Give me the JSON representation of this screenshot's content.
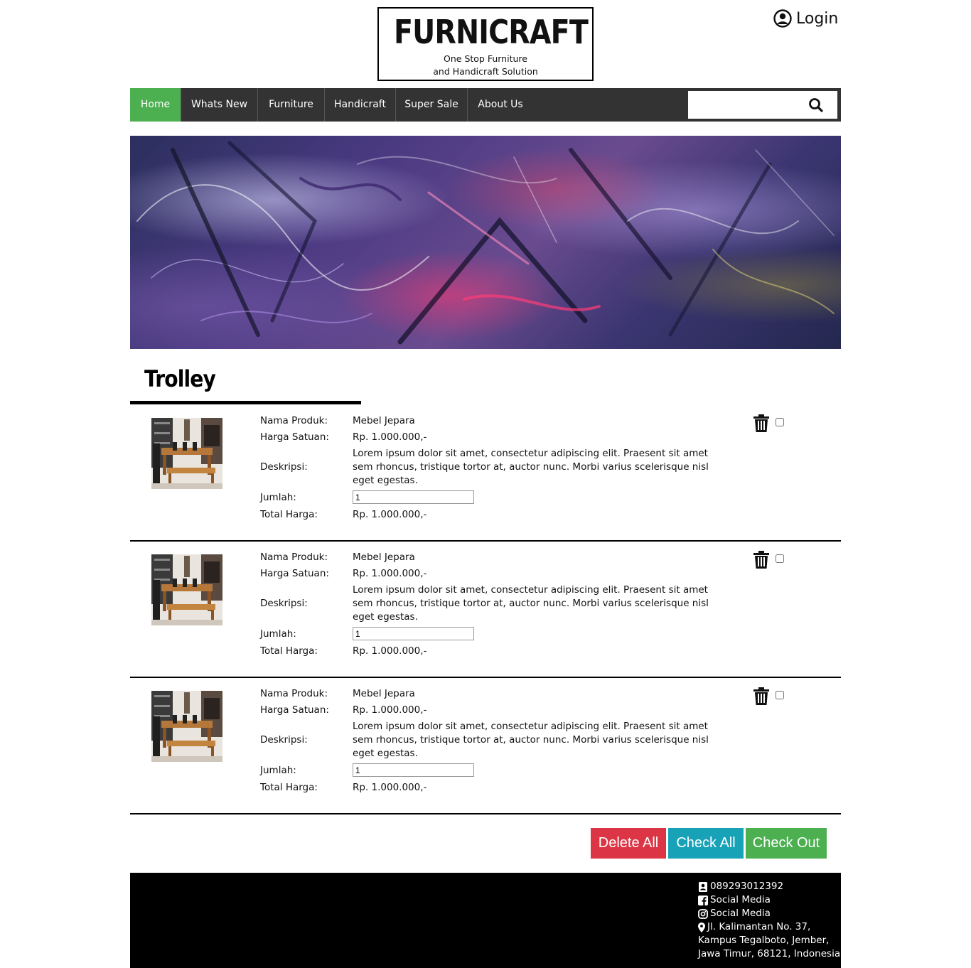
{
  "header": {
    "logo_title": "FURNICRAFT",
    "logo_tagline_1": "One Stop Furniture",
    "logo_tagline_2": "and Handicraft Solution",
    "login_label": "Login"
  },
  "nav": {
    "items": [
      {
        "label": "Home",
        "active": true
      },
      {
        "label": "Whats New",
        "active": false
      },
      {
        "label": "Furniture",
        "active": false
      },
      {
        "label": "Handicraft",
        "active": false
      },
      {
        "label": "Super Sale",
        "active": false
      },
      {
        "label": "About Us",
        "active": false
      }
    ],
    "search_placeholder": "",
    "search_icon": "search-icon",
    "active_color": "#4caf50",
    "bar_color": "#333333"
  },
  "page": {
    "title": "Trolley"
  },
  "labels": {
    "name": "Nama Produk:",
    "unit_price": "Harga Satuan:",
    "description": "Deskripsi:",
    "quantity": "Jumlah:",
    "total": "Total Harga:"
  },
  "items": [
    {
      "name": "Mebel Jepara",
      "unit_price": "Rp. 1.000.000,-",
      "description": "Lorem ipsum dolor sit amet, consectetur adipiscing elit. Praesent sit amet sem rhoncus, tristique tortor at, auctor nunc. Morbi varius scelerisque nisl eget egestas.",
      "quantity": "1",
      "total": "Rp. 1.000.000,-",
      "checked": false
    },
    {
      "name": "Mebel Jepara",
      "unit_price": "Rp. 1.000.000,-",
      "description": "Lorem ipsum dolor sit amet, consectetur adipiscing elit. Praesent sit amet sem rhoncus, tristique tortor at, auctor nunc. Morbi varius scelerisque nisl eget egestas.",
      "quantity": "1",
      "total": "Rp. 1.000.000,-",
      "checked": false
    },
    {
      "name": "Mebel Jepara",
      "unit_price": "Rp. 1.000.000,-",
      "description": "Lorem ipsum dolor sit amet, consectetur adipiscing elit. Praesent sit amet sem rhoncus, tristique tortor at, auctor nunc. Morbi varius scelerisque nisl eget egestas.",
      "quantity": "1",
      "total": "Rp. 1.000.000,-",
      "checked": false
    }
  ],
  "actions": {
    "delete_all": "Delete All",
    "check_all": "Check All",
    "check_out": "Check Out",
    "colors": {
      "delete": "#dc3545",
      "check": "#17a2b8",
      "checkout": "#4caf50"
    }
  },
  "footer": {
    "phone": "089293012392",
    "social_1": "Social Media",
    "social_2": "Social Media",
    "address_1": "Jl. Kalimantan No. 37,",
    "address_2": "Kampus Tegalboto, Jember,",
    "address_3": "Jawa Timur, 68121, Indonesia",
    "icons": [
      "contact-icon",
      "facebook-icon",
      "instagram-icon",
      "map-marker-icon"
    ]
  }
}
